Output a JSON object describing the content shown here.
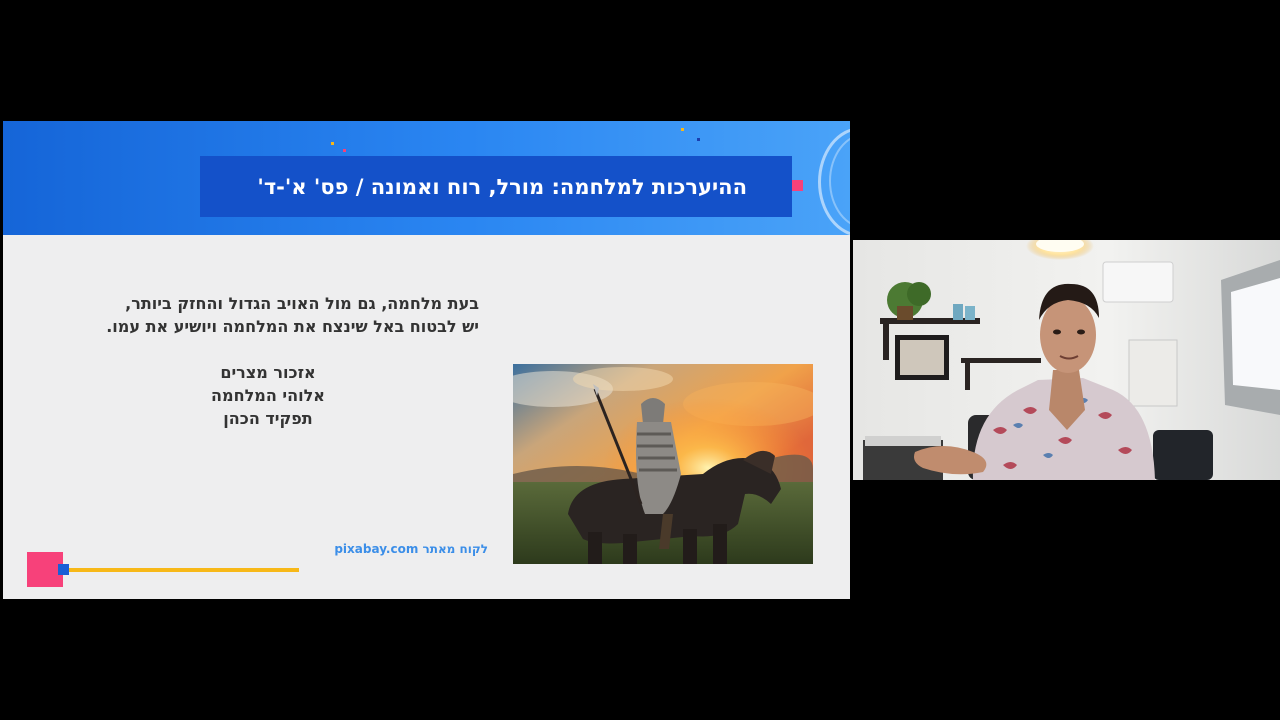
{
  "slide": {
    "title": "ההיערכות למלחמה: מורל, רוח ואמונה / פס' א'-ד'",
    "paragraph_lines": [
      "בעת מלחמה, גם מול האויב הגדול והחזק ביותר,",
      "יש לבטוח באל שינצח את המלחמה ויושיע את עמו."
    ],
    "list_items": [
      "אזכור מצרים",
      "אלוהי המלחמה",
      "תפקיד הכהן"
    ],
    "image_credit": "לקוח מאתר pixabay.com",
    "colors": {
      "header_blue": "#2a86f2",
      "title_box": "#1451c9",
      "accent_pink": "#f7417a",
      "accent_yellow": "#f7b818",
      "credit_blue": "#3b8ee8"
    }
  },
  "webcam": {
    "description_icon": "presenter-video-feed"
  }
}
